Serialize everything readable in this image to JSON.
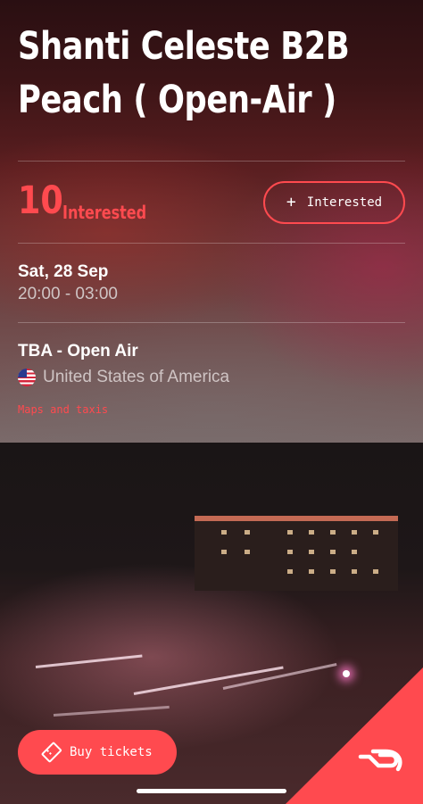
{
  "event": {
    "title": "Shanti Celeste B2B Peach ( Open-Air )",
    "interested_count": "10",
    "interested_label": "Interested",
    "interested_button_label": "Interested",
    "date": "Sat, 28 Sep",
    "time": "20:00 - 03:00",
    "venue": "TBA - Open Air",
    "country": "United States of America",
    "maps_link": "Maps and taxis"
  },
  "footer": {
    "buy_tickets_label": "Buy tickets"
  },
  "colors": {
    "accent": "#ff4a4f",
    "background_top": "#2a0f12",
    "text_secondary": "#cfc4c4"
  },
  "icons": {
    "add": "plus-icon",
    "flag": "us-flag-icon",
    "ticket": "ticket-icon",
    "logo": "ra-logo-icon"
  }
}
